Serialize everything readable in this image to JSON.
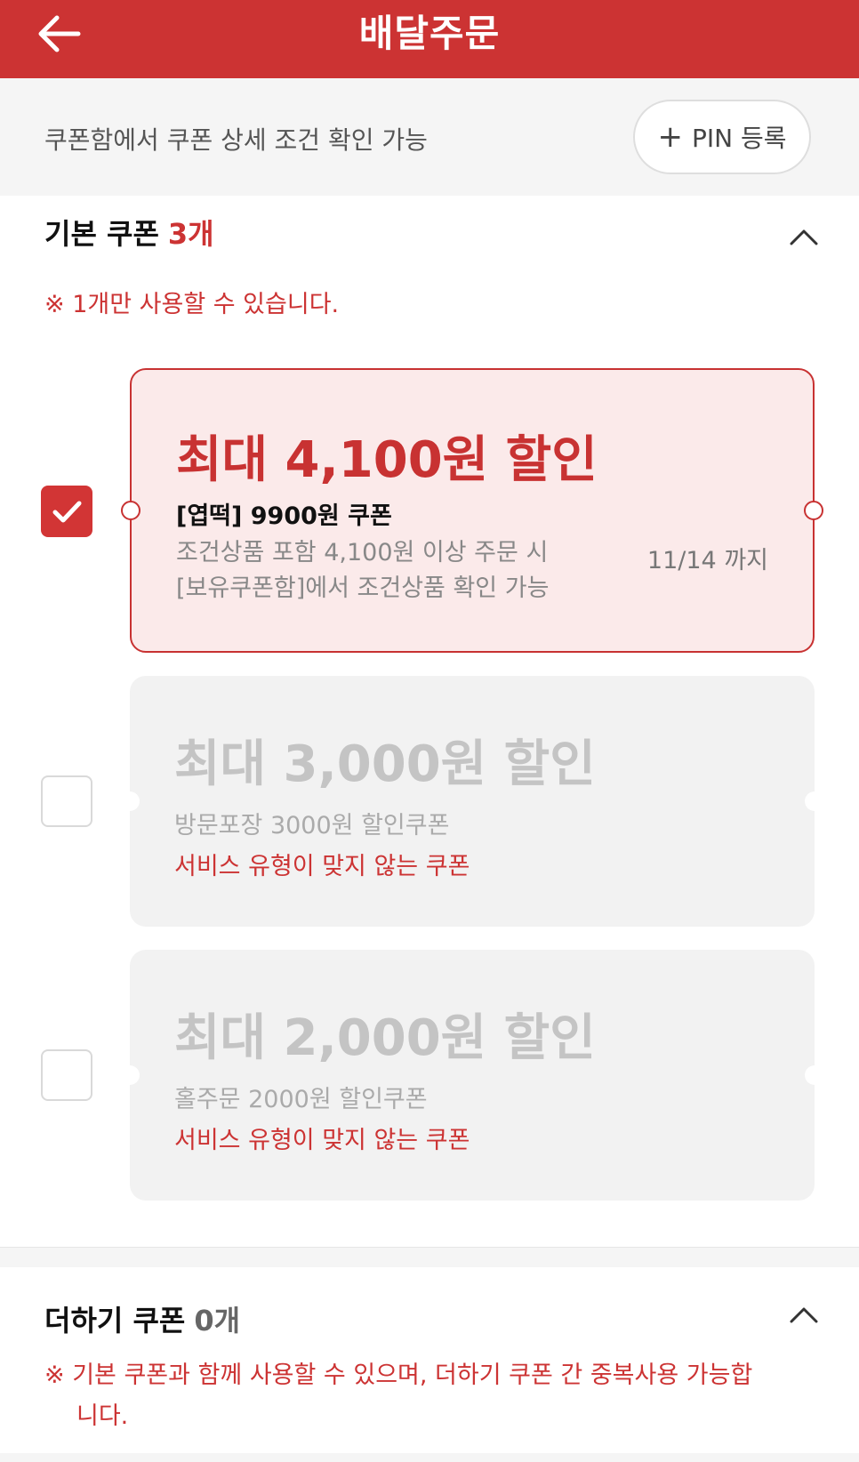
{
  "header": {
    "title": "배달주문",
    "back_icon": "arrow-left-icon",
    "background": "#cc3333"
  },
  "info": {
    "text": "쿠폰함에서 쿠폰 상세 조건 확인 가능",
    "pin_label": "PIN 등록",
    "pin_icon": "plus-icon"
  },
  "basic": {
    "title": "기본 쿠폰",
    "count": "3개",
    "notice": "※ 1개만 사용할 수 있습니다.",
    "expanded": true,
    "coupons": [
      {
        "amount": "최대 4,100원 할인",
        "name": "[엽떡] 9900원 쿠폰",
        "cond1": "조건상품 포함 4,100원 이상 주문 시",
        "cond2": "[보유쿠폰함]에서 조건상품 확인 가능",
        "expiry": "11/14 까지",
        "checked": true
      },
      {
        "amount": "최대 3,000원 할인",
        "name": "방문포장 3000원 할인쿠폰",
        "warning": "서비스 유형이 맞지 않는 쿠폰",
        "checked": false
      },
      {
        "amount": "최대 2,000원 할인",
        "name": "홀주문 2000원 할인쿠폰",
        "warning": "서비스 유형이 맞지 않는 쿠폰",
        "checked": false
      }
    ]
  },
  "plus": {
    "title": "더하기 쿠폰",
    "count": "0개",
    "notice_line1": "※ 기본 쿠폰과 함께 사용할 수 있으며, 더하기 쿠폰 간 중복사용 가능합",
    "notice_line2": "니다.",
    "expanded": true
  },
  "colors": {
    "accent": "#cc3333",
    "active_bg": "#fbeaea",
    "inactive_bg": "#f2f2f2"
  }
}
